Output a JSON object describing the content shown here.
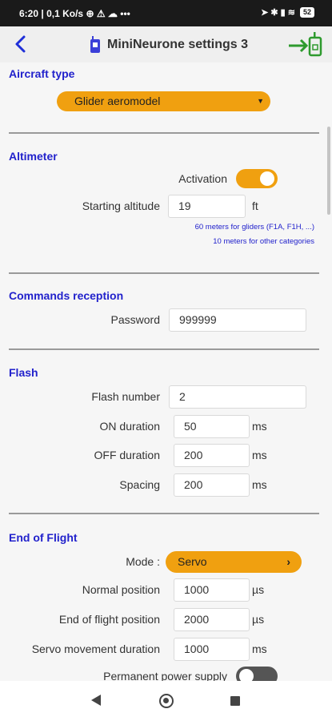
{
  "status": {
    "time": "6:20",
    "speed": "0,1 Ko/s",
    "extras": "⊕ ⚠ ☁ •••",
    "indicators": "➤ ✱ ▮ ≋",
    "battery": "52"
  },
  "header": {
    "title": "MiniNeurone settings 3"
  },
  "aircraft": {
    "title": "Aircraft type",
    "selected": "Glider aeromodel"
  },
  "altimeter": {
    "title": "Altimeter",
    "activation_label": "Activation",
    "activation_on": true,
    "start_label": "Starting altitude",
    "start_value": "19",
    "start_unit": "ft",
    "hint1": "60 meters for gliders (F1A, F1H, ...)",
    "hint2": "10 meters for other categories"
  },
  "commands": {
    "title": "Commands reception",
    "password_label": "Password",
    "password_value": "999999"
  },
  "flash": {
    "title": "Flash",
    "number_label": "Flash number",
    "number_value": "2",
    "on_label": "ON duration",
    "on_value": "50",
    "off_label": "OFF duration",
    "off_value": "200",
    "spacing_label": "Spacing",
    "spacing_value": "200",
    "unit": "ms"
  },
  "eof": {
    "title": "End of Flight",
    "mode_label": "Mode :",
    "mode_value": "Servo",
    "normal_label": "Normal position",
    "normal_value": "1000",
    "eof_pos_label": "End of flight position",
    "eof_pos_value": "2000",
    "pos_unit": "µs",
    "movement_label": "Servo movement duration",
    "movement_value": "1000",
    "movement_unit": "ms",
    "power_label": "Permanent power supply",
    "power_on": false
  },
  "colors": {
    "accent": "#f0a010",
    "section": "#2222cc",
    "green": "#2e9a2e"
  }
}
